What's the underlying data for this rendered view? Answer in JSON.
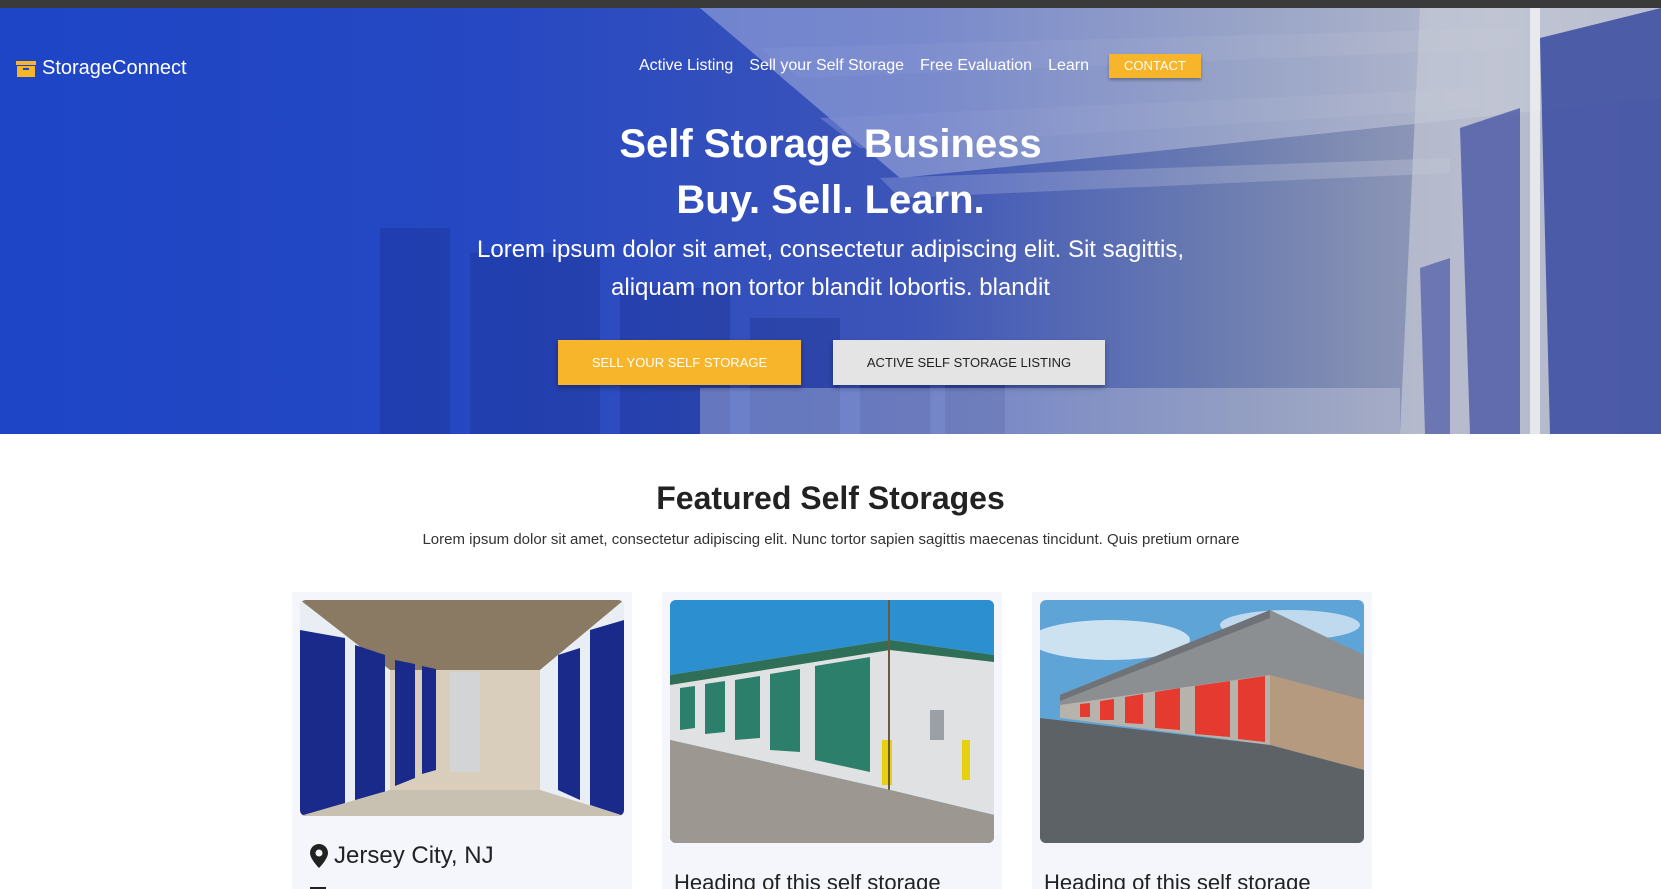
{
  "brand": {
    "name": "StorageConnect",
    "icon": "box-icon",
    "icon_color": "#f7b52c"
  },
  "nav": {
    "items": [
      {
        "label": "Active Listing"
      },
      {
        "label": "Sell your Self Storage"
      },
      {
        "label": "Free Evaluation"
      },
      {
        "label": "Learn"
      }
    ],
    "contact_label": "CONTACT"
  },
  "hero": {
    "title_line1": "Self Storage Business",
    "title_line2": "Buy. Sell. Learn.",
    "subtitle": "Lorem ipsum dolor sit amet, consectetur adipiscing elit. Sit sagittis, aliquam non tortor blandit lobortis. blandit",
    "primary_cta": "SELL YOUR SELF STORAGE",
    "secondary_cta": "ACTIVE SELF STORAGE LISTING"
  },
  "featured": {
    "title": "Featured Self Storages",
    "description": "Lorem ipsum dolor sit amet, consectetur adipiscing elit. Nunc tortor sapien sagittis maecenas tincidunt. Quis pretium ornare",
    "cards": [
      {
        "location": "Jersey City, NJ",
        "heading": ""
      },
      {
        "location": "",
        "heading": "Heading of this self storage"
      },
      {
        "location": "",
        "heading": "Heading of this self storage"
      }
    ]
  },
  "colors": {
    "accent": "#f7b52c",
    "hero_blue": "#1d45c6",
    "secondary_button": "#e4e4e4"
  }
}
